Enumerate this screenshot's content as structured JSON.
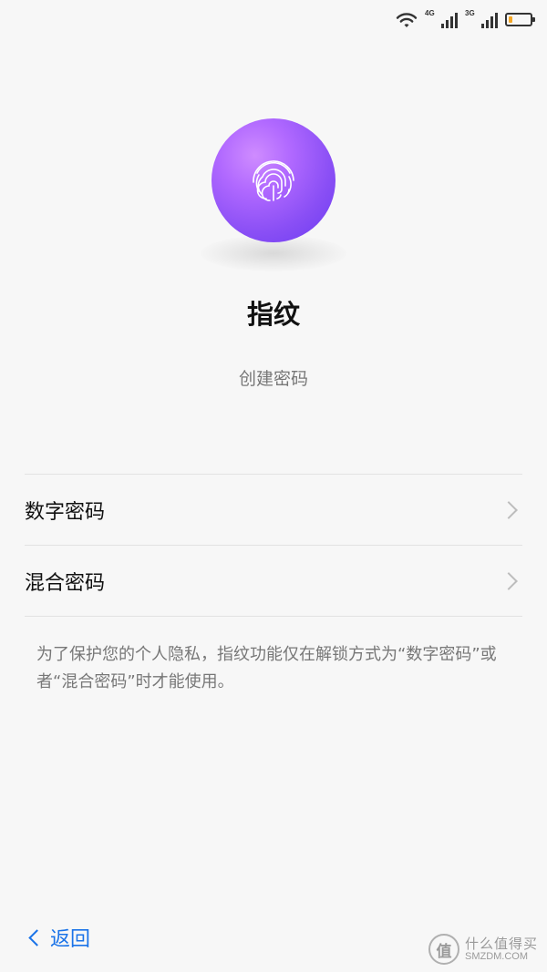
{
  "status_bar": {
    "net1": "4G",
    "net2": "3G",
    "battery_level": 0.2
  },
  "icons": {
    "wifi": "wifi-icon",
    "signal": "signal-icon",
    "battery": "battery-icon",
    "fingerprint": "fingerprint-icon",
    "chevron": "chevron-right-icon",
    "back": "chevron-left-icon"
  },
  "colors": {
    "accent": "#1a73e8",
    "orb_light": "#cf8cff",
    "orb_dark": "#6a3af0",
    "battery_fill": "#f5a623"
  },
  "header": {
    "title": "指纹",
    "subtitle": "创建密码"
  },
  "options": [
    {
      "label": "数字密码"
    },
    {
      "label": "混合密码"
    }
  ],
  "hint": "为了保护您的个人隐私，指纹功能仅在解锁方式为“数字密码”或者“混合密码”时才能使用。",
  "footer": {
    "back_label": "返回"
  },
  "watermark": {
    "cn": "什么值得买",
    "en": "SMZDM.COM",
    "logo": "值"
  }
}
